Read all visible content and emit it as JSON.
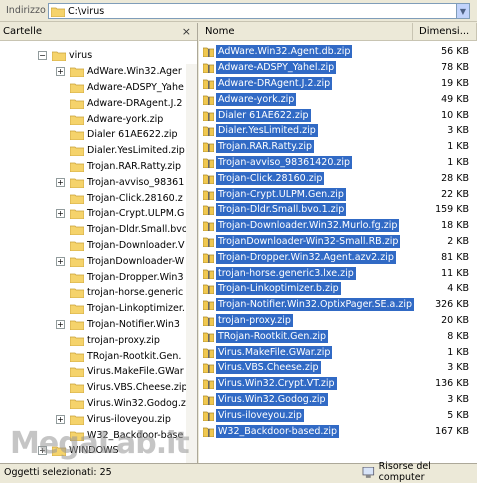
{
  "address": {
    "label": "Indirizzo",
    "path": "C:\\virus"
  },
  "tree": {
    "title": "Cartelle",
    "close": "×",
    "root": "virus",
    "items": [
      {
        "label": "AdWare.Win32.Ager",
        "exp": "+"
      },
      {
        "label": "Adware-ADSPY_Yahe",
        "exp": ""
      },
      {
        "label": "Adware-DRAgent.J.2",
        "exp": ""
      },
      {
        "label": "Adware-york.zip",
        "exp": ""
      },
      {
        "label": "Dialer 61AE622.zip",
        "exp": ""
      },
      {
        "label": "Dialer.YesLimited.zip",
        "exp": ""
      },
      {
        "label": "Trojan.RAR.Ratty.zip",
        "exp": ""
      },
      {
        "label": "Trojan-avviso_98361",
        "exp": "+"
      },
      {
        "label": "Trojan-Click.28160.z",
        "exp": ""
      },
      {
        "label": "Trojan-Crypt.ULPM.G",
        "exp": "+"
      },
      {
        "label": "Trojan-Dldr.Small.bvo",
        "exp": ""
      },
      {
        "label": "Trojan-Downloader.V",
        "exp": ""
      },
      {
        "label": "TrojanDownloader-W",
        "exp": "+"
      },
      {
        "label": "Trojan-Dropper.Win3",
        "exp": ""
      },
      {
        "label": "trojan-horse.generic",
        "exp": ""
      },
      {
        "label": "Trojan-Linkoptimizer.",
        "exp": ""
      },
      {
        "label": "Trojan-Notifier.Win3",
        "exp": "+"
      },
      {
        "label": "trojan-proxy.zip",
        "exp": ""
      },
      {
        "label": "TRojan-Rootkit.Gen.",
        "exp": ""
      },
      {
        "label": "Virus.MakeFile.GWar",
        "exp": ""
      },
      {
        "label": "Virus.VBS.Cheese.zip",
        "exp": ""
      },
      {
        "label": "Virus.Win32.Godog.z",
        "exp": ""
      },
      {
        "label": "Virus-iloveyou.zip",
        "exp": "+"
      },
      {
        "label": "W32_Backdoor-base",
        "exp": ""
      }
    ],
    "after": {
      "label": "WINDOWS",
      "exp": "+"
    }
  },
  "list": {
    "columns": {
      "name": "Nome",
      "size": "Dimensi..."
    },
    "files": [
      {
        "name": "AdWare.Win32.Agent.db.zip",
        "size": "56 KB"
      },
      {
        "name": "Adware-ADSPY_Yahel.zip",
        "size": "78 KB"
      },
      {
        "name": "Adware-DRAgent.J.2.zip",
        "size": "19 KB"
      },
      {
        "name": "Adware-york.zip",
        "size": "49 KB"
      },
      {
        "name": "Dialer 61AE622.zip",
        "size": "10 KB"
      },
      {
        "name": "Dialer.YesLimited.zip",
        "size": "3 KB"
      },
      {
        "name": "Trojan.RAR.Ratty.zip",
        "size": "1 KB"
      },
      {
        "name": "Trojan-avviso_98361420.zip",
        "size": "1 KB"
      },
      {
        "name": "Trojan-Click.28160.zip",
        "size": "28 KB"
      },
      {
        "name": "Trojan-Crypt.ULPM.Gen.zip",
        "size": "22 KB"
      },
      {
        "name": "Trojan-Dldr.Small.bvo.1.zip",
        "size": "159 KB"
      },
      {
        "name": "Trojan-Downloader.Win32.Murlo.fg.zip",
        "size": "18 KB"
      },
      {
        "name": "TrojanDownloader-Win32-Small.RB.zip",
        "size": "2 KB"
      },
      {
        "name": "Trojan-Dropper.Win32.Agent.azv2.zip",
        "size": "81 KB"
      },
      {
        "name": "trojan-horse.generic3.lxe.zip",
        "size": "11 KB"
      },
      {
        "name": "Trojan-Linkoptimizer.b.zip",
        "size": "4 KB"
      },
      {
        "name": "Trojan-Notifier.Win32.OptixPager.SE.a.zip",
        "size": "326 KB"
      },
      {
        "name": "trojan-proxy.zip",
        "size": "20 KB"
      },
      {
        "name": "TRojan-Rootkit.Gen.zip",
        "size": "8 KB"
      },
      {
        "name": "Virus.MakeFile.GWar.zip",
        "size": "1 KB"
      },
      {
        "name": "Virus.VBS.Cheese.zip",
        "size": "3 KB"
      },
      {
        "name": "Virus.Win32.Crypt.VT.zip",
        "size": "136 KB"
      },
      {
        "name": "Virus.Win32.Godog.zip",
        "size": "3 KB"
      },
      {
        "name": "Virus-iloveyou.zip",
        "size": "5 KB"
      },
      {
        "name": "W32_Backdoor-based.zip",
        "size": "167 KB"
      }
    ]
  },
  "status": {
    "left": "Oggetti selezionati: 25",
    "right": "Risorse del computer"
  },
  "watermark": "MegaLab.it",
  "colors": {
    "selection": "#316ac5",
    "folder": "#f5d36b"
  }
}
